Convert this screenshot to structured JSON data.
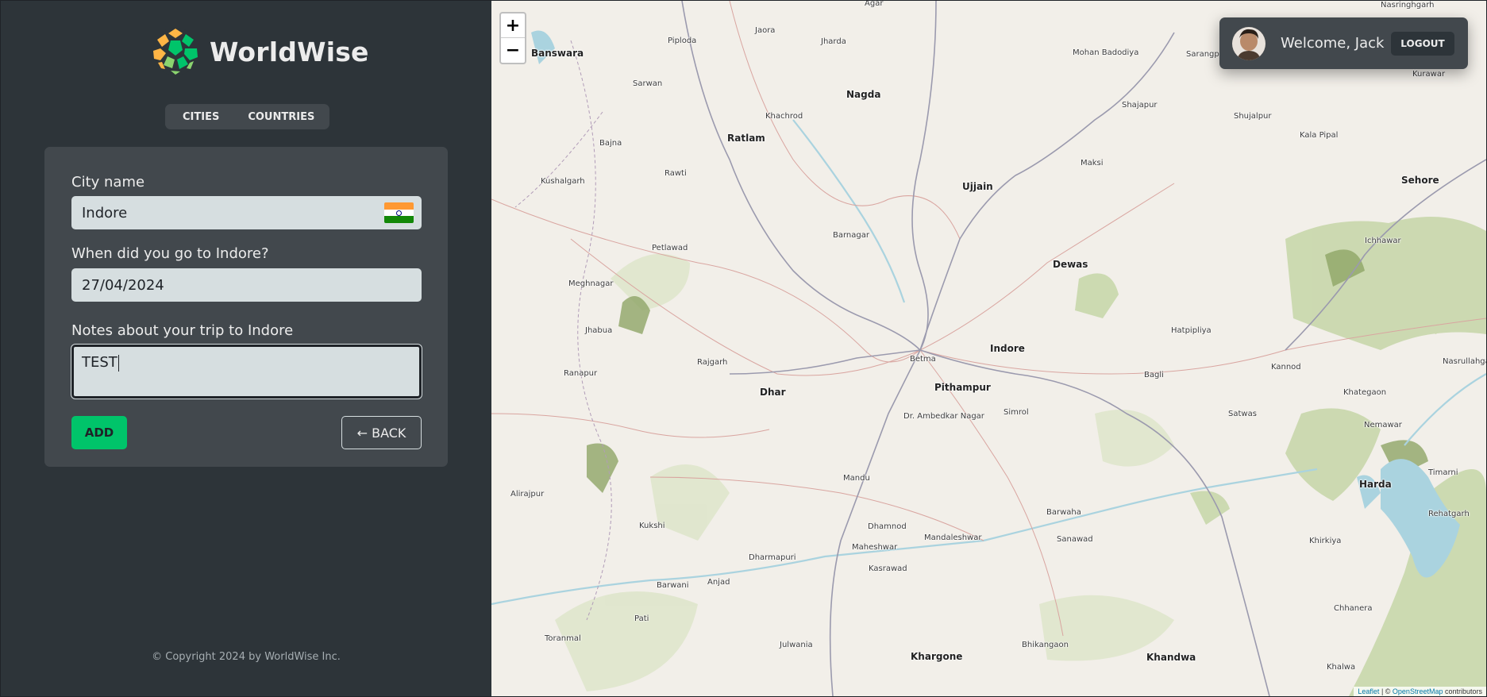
{
  "app": {
    "name": "WorldWise"
  },
  "tabs": [
    {
      "label": "Cities"
    },
    {
      "label": "Countries"
    }
  ],
  "form": {
    "city_label": "City name",
    "city_value": "Indore",
    "city_flag": "india-flag",
    "date_label": "When did you go to Indore?",
    "date_value": "27/04/2024",
    "notes_label": "Notes about your trip to Indore",
    "notes_value": "TEST",
    "add_label": "Add",
    "back_label": "← BACK"
  },
  "footer": {
    "copyright": "© Copyright 2024 by WorldWise Inc."
  },
  "user": {
    "welcome": "Welcome, Jack",
    "logout_label": "Logout"
  },
  "map": {
    "zoom_in": "+",
    "zoom_out": "−",
    "attribution_leaflet": "Leaflet",
    "attribution_sep": " | © ",
    "attribution_osm": "OpenStreetMap",
    "attribution_suffix": " contributors",
    "places": [
      {
        "name": "Agar",
        "major": false
      },
      {
        "name": "Nasringhgarh",
        "major": false
      },
      {
        "name": "Banswara",
        "major": true
      },
      {
        "name": "Piploda",
        "major": false
      },
      {
        "name": "Jaora",
        "major": false
      },
      {
        "name": "Jharda",
        "major": false
      },
      {
        "name": "Mohan Badodiya",
        "major": false
      },
      {
        "name": "Sarangpur",
        "major": false
      },
      {
        "name": "Kurawar",
        "major": false
      },
      {
        "name": "Sarwan",
        "major": false
      },
      {
        "name": "Nagda",
        "major": true
      },
      {
        "name": "Shajapur",
        "major": false
      },
      {
        "name": "Khachrod",
        "major": false
      },
      {
        "name": "Shujalpur",
        "major": false
      },
      {
        "name": "Ratlam",
        "major": true
      },
      {
        "name": "Kala Pipal",
        "major": false
      },
      {
        "name": "Bajna",
        "major": false
      },
      {
        "name": "Maksi",
        "major": false
      },
      {
        "name": "Rawti",
        "major": false
      },
      {
        "name": "Ujjain",
        "major": true
      },
      {
        "name": "Sehore",
        "major": true
      },
      {
        "name": "Kushalgarh",
        "major": false
      },
      {
        "name": "Barnagar",
        "major": false
      },
      {
        "name": "Ichhawar",
        "major": false
      },
      {
        "name": "Petlawad",
        "major": false
      },
      {
        "name": "Dewas",
        "major": true
      },
      {
        "name": "Meghnagar",
        "major": false
      },
      {
        "name": "Hatpipliya",
        "major": false
      },
      {
        "name": "Jhabua",
        "major": false
      },
      {
        "name": "Indore",
        "major": true
      },
      {
        "name": "Betma",
        "major": false
      },
      {
        "name": "Rajgarh",
        "major": false
      },
      {
        "name": "Kannod",
        "major": false
      },
      {
        "name": "Nasrullahganj",
        "major": false
      },
      {
        "name": "Ranapur",
        "major": false
      },
      {
        "name": "Pithampur",
        "major": true
      },
      {
        "name": "Bagli",
        "major": false
      },
      {
        "name": "Dhar",
        "major": true
      },
      {
        "name": "Khategaon",
        "major": false
      },
      {
        "name": "Dr. Ambedkar Nagar",
        "major": false
      },
      {
        "name": "Simrol",
        "major": false
      },
      {
        "name": "Satwas",
        "major": false
      },
      {
        "name": "Nemawar",
        "major": false
      },
      {
        "name": "Alirajpur",
        "major": false
      },
      {
        "name": "Mandu",
        "major": false
      },
      {
        "name": "Timarni",
        "major": false
      },
      {
        "name": "Harda",
        "major": true
      },
      {
        "name": "Barwaha",
        "major": false
      },
      {
        "name": "Rehatgarh",
        "major": false
      },
      {
        "name": "Kukshi",
        "major": false
      },
      {
        "name": "Dhamnod",
        "major": false
      },
      {
        "name": "Mandaleshwar",
        "major": false
      },
      {
        "name": "Sanawad",
        "major": false
      },
      {
        "name": "Khirkiya",
        "major": false
      },
      {
        "name": "Maheshwar",
        "major": false
      },
      {
        "name": "Dharmapuri",
        "major": false
      },
      {
        "name": "Kasrawad",
        "major": false
      },
      {
        "name": "Barwani",
        "major": false
      },
      {
        "name": "Anjad",
        "major": false
      },
      {
        "name": "Chhanera",
        "major": false
      },
      {
        "name": "Pati",
        "major": false
      },
      {
        "name": "Toranmal",
        "major": false
      },
      {
        "name": "Julwania",
        "major": false
      },
      {
        "name": "Khargone",
        "major": true
      },
      {
        "name": "Bhikangaon",
        "major": false
      },
      {
        "name": "Khandwa",
        "major": true
      },
      {
        "name": "Khalwa",
        "major": false
      }
    ]
  }
}
